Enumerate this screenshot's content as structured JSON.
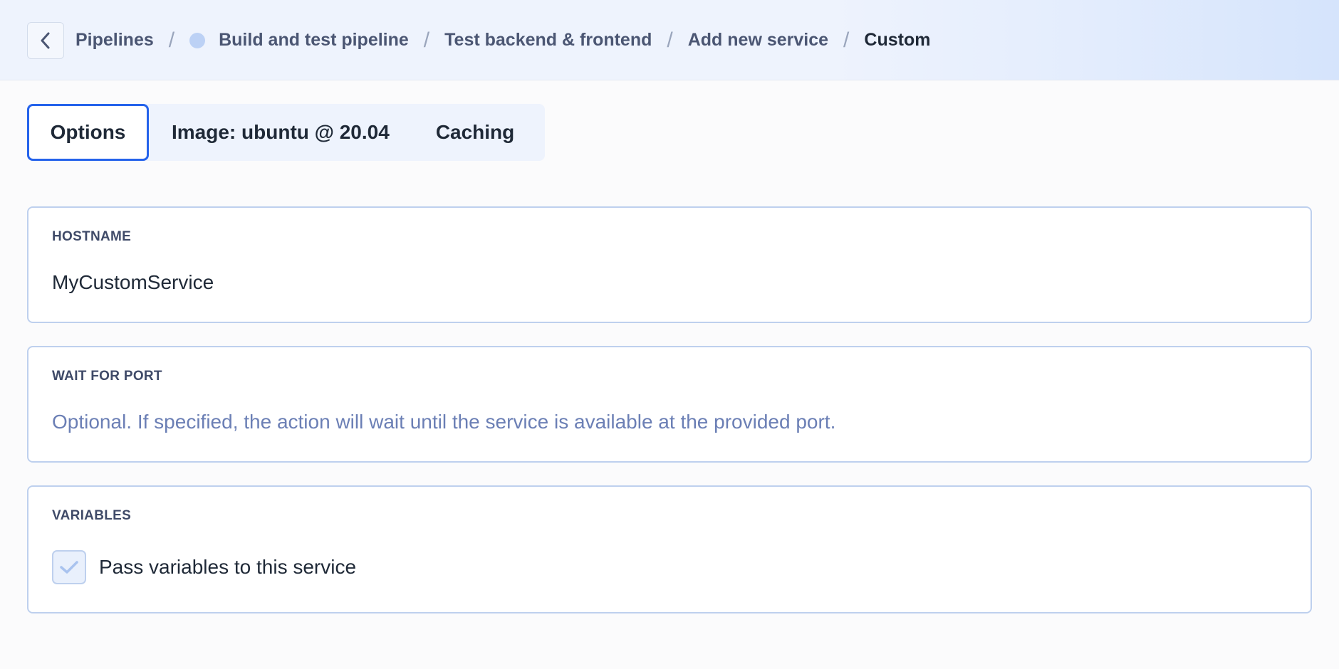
{
  "breadcrumb": {
    "back_icon": "chevron-left-icon",
    "items": [
      {
        "label": "Pipelines"
      },
      {
        "label": "Build and test pipeline",
        "status_dot_color": "#bcd1f5"
      },
      {
        "label": "Test backend & frontend"
      },
      {
        "label": "Add new service"
      },
      {
        "label": "Custom"
      }
    ],
    "separator": "/"
  },
  "tabs": [
    {
      "label": "Options",
      "active": true
    },
    {
      "label": "Image: ubuntu @ 20.04",
      "active": false
    },
    {
      "label": "Caching",
      "active": false
    }
  ],
  "fields": {
    "hostname": {
      "label": "HOSTNAME",
      "value": "MyCustomService"
    },
    "wait_for_port": {
      "label": "WAIT FOR PORT",
      "value": "",
      "placeholder": "Optional. If specified, the action will wait until the service is available at the provided port."
    },
    "variables": {
      "label": "VARIABLES",
      "checkbox_label": "Pass variables to this service",
      "checked": true
    }
  },
  "colors": {
    "accent": "#2563eb",
    "border": "#bed0ee",
    "placeholder": "#6b7fb5"
  }
}
